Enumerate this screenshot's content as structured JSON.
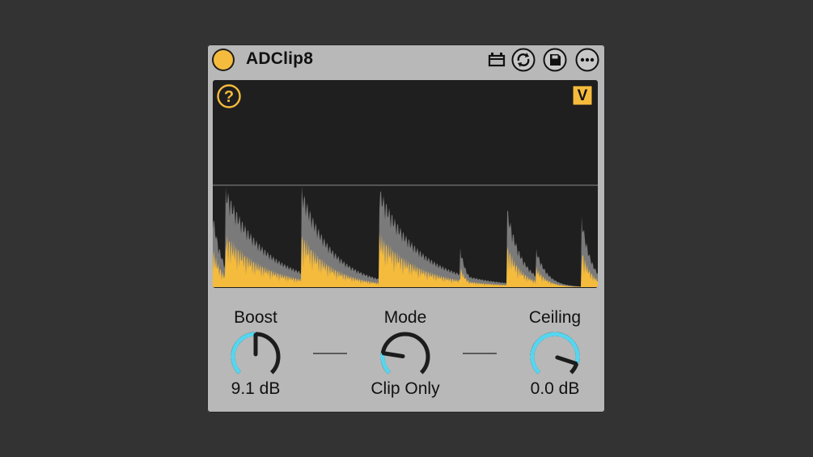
{
  "device": {
    "name": "ADClip8",
    "power_on": true,
    "accent_color": "#f5bb3c",
    "meter_color": "#55d6f0"
  },
  "title_icons": [
    {
      "name": "hot-swap-icon"
    },
    {
      "name": "swap-cycle-icon"
    },
    {
      "name": "save-preset-icon"
    },
    {
      "name": "more-options-icon"
    }
  ],
  "display": {
    "help_symbol": "?",
    "view_toggle_label": "V"
  },
  "knobs": [
    {
      "id": "boost",
      "label": "Boost",
      "value": "9.1 dB",
      "position": 0.5
    },
    {
      "id": "mode",
      "label": "Mode",
      "value": "Clip Only",
      "position": 0.2
    },
    {
      "id": "ceiling",
      "label": "Ceiling",
      "value": "0.0 dB",
      "position": 0.9
    }
  ]
}
